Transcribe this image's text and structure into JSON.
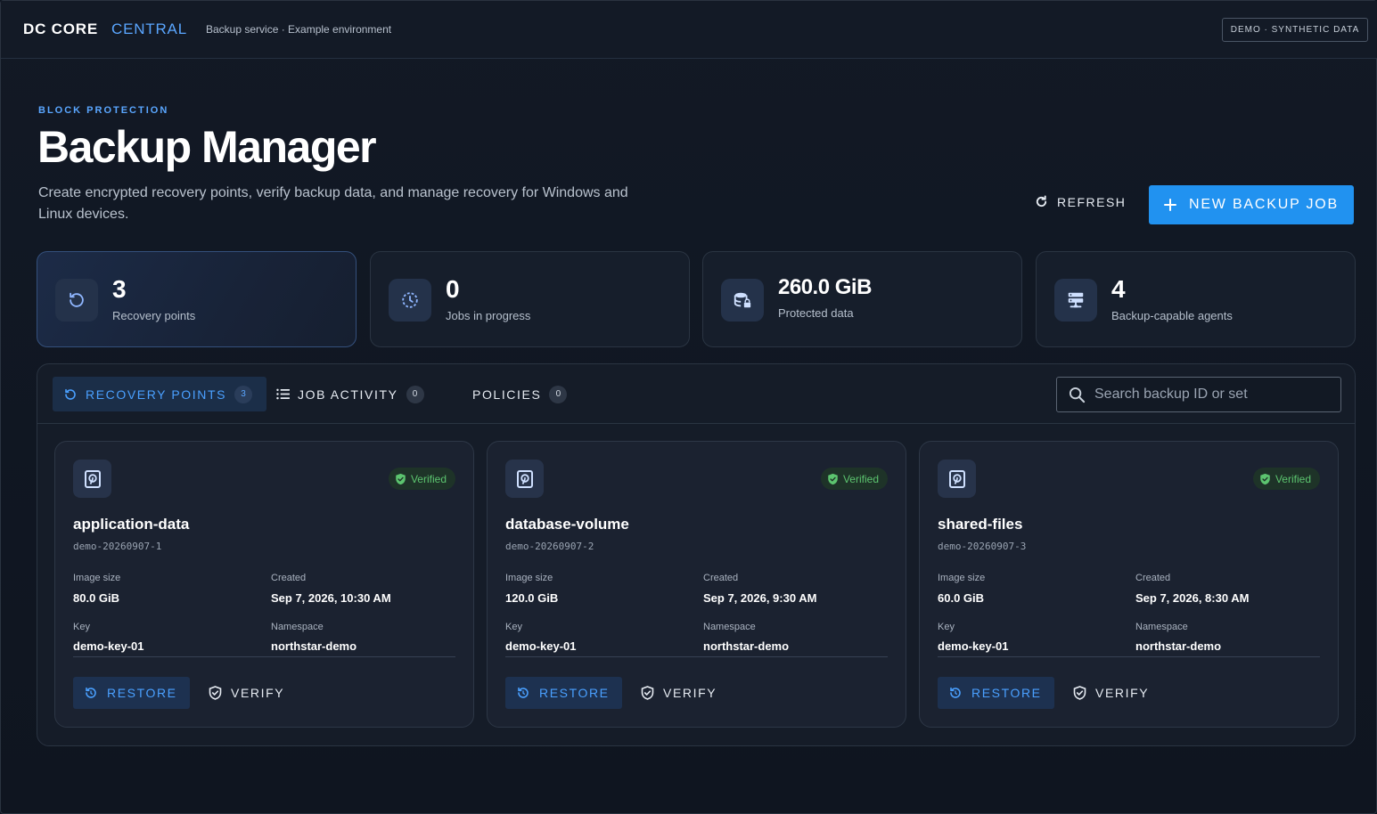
{
  "header": {
    "brand_primary": "DC CORE",
    "brand_secondary": "CENTRAL",
    "subtitle": "Backup service · Example environment",
    "demo_badge": "DEMO · SYNTHETIC DATA"
  },
  "hero": {
    "eyebrow": "BLOCK PROTECTION",
    "title": "Backup Manager",
    "description": "Create encrypted recovery points, verify backup data, and manage recovery for Windows and Linux devices.",
    "refresh_label": "REFRESH",
    "new_job_label": "NEW BACKUP JOB"
  },
  "stats": [
    {
      "value": "3",
      "label": "Recovery points",
      "icon": "restore-clock-icon"
    },
    {
      "value": "0",
      "label": "Jobs in progress",
      "icon": "clock-progress-icon"
    },
    {
      "value": "260.0 GiB",
      "label": "Protected data",
      "icon": "database-lock-icon"
    },
    {
      "value": "4",
      "label": "Backup-capable agents",
      "icon": "server-agents-icon"
    }
  ],
  "tabs": [
    {
      "label": "RECOVERY POINTS",
      "count": "3",
      "icon": "restore-clock-icon",
      "active": true
    },
    {
      "label": "JOB ACTIVITY",
      "count": "0",
      "icon": "list-icon",
      "active": false
    },
    {
      "label": "POLICIES",
      "count": "0",
      "active": false
    }
  ],
  "search": {
    "placeholder": "Search backup ID or set"
  },
  "field_labels": {
    "image_size": "Image size",
    "created": "Created",
    "key": "Key",
    "namespace": "Namespace"
  },
  "card_actions": {
    "restore": "RESTORE",
    "verify": "VERIFY"
  },
  "recovery_points": [
    {
      "name": "application-data",
      "id": "demo-20260907-1",
      "status": "Verified",
      "image_size": "80.0 GiB",
      "created": "Sep 7, 2026, 10:30 AM",
      "key": "demo-key-01",
      "namespace": "northstar-demo"
    },
    {
      "name": "database-volume",
      "id": "demo-20260907-2",
      "status": "Verified",
      "image_size": "120.0 GiB",
      "created": "Sep 7, 2026, 9:30 AM",
      "key": "demo-key-01",
      "namespace": "northstar-demo"
    },
    {
      "name": "shared-files",
      "id": "demo-20260907-3",
      "status": "Verified",
      "image_size": "60.0 GiB",
      "created": "Sep 7, 2026, 8:30 AM",
      "key": "demo-key-01",
      "namespace": "northstar-demo"
    }
  ],
  "colors": {
    "accent": "#2192f0",
    "accent_text": "#4aa0ff",
    "verified": "#5cc46f",
    "background": "#101622"
  }
}
